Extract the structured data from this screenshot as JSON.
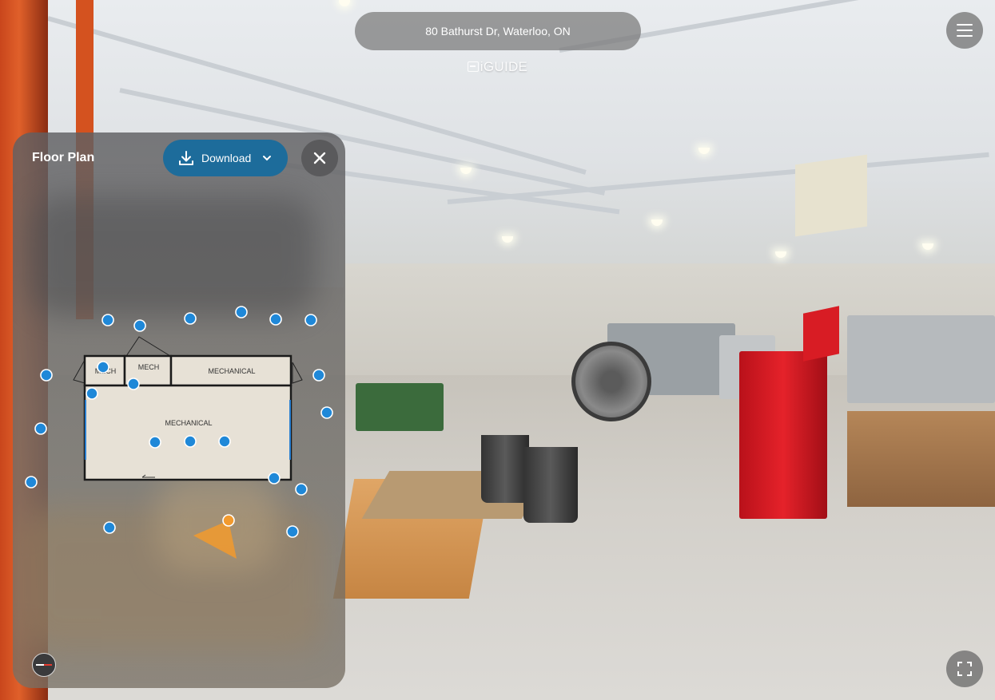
{
  "viewer": {
    "address": "80 Bathurst Dr, Waterloo, ON",
    "brand": "iGUIDE",
    "menu_icon": "hamburger-menu-icon",
    "fullscreen_icon": "fullscreen-icon"
  },
  "floor_plan": {
    "title": "Floor Plan",
    "download_label": "Download",
    "download_icon": "download-icon",
    "dropdown_icon": "chevron-down-icon",
    "close_icon": "close-icon",
    "compass_icon": "compass-icon",
    "rooms": [
      {
        "label": "MECH"
      },
      {
        "label": "MECH"
      },
      {
        "label": "MECHANICAL"
      },
      {
        "label": "MECHANICAL"
      }
    ],
    "colors": {
      "download_button": "#1d6c9b",
      "room_fill": "#e7e1d6",
      "pano_point": "#1f88d8",
      "current_point": "#f29a2e"
    }
  }
}
